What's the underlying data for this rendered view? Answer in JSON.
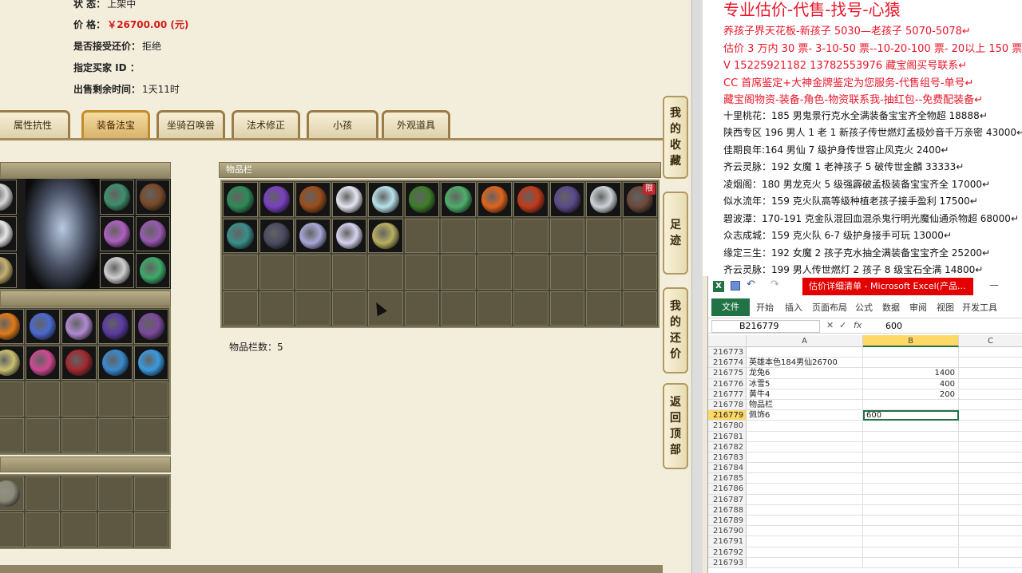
{
  "game": {
    "info": [
      {
        "label": "状      态：",
        "value": "上架中",
        "price": false
      },
      {
        "label": "价      格：",
        "value": "￥26700.00 (元)",
        "price": true
      },
      {
        "label": "是否接受还价：",
        "value": "拒绝",
        "price": false
      },
      {
        "label": "指定买家 ID ：",
        "value": "",
        "price": false
      },
      {
        "label": "出售剩余时间：",
        "value": "1天11时",
        "price": false
      }
    ],
    "tabs": [
      "属性抗性",
      "装备法宝",
      "坐骑召唤兽",
      "法术修正",
      "小孩",
      "外观道具"
    ],
    "active_tab": "装备法宝",
    "inventory_title": "物品栏",
    "inventory_count": "物品栏数：5",
    "limit_badge": "限",
    "side_buttons": [
      {
        "chars": [
          "我",
          "的",
          "收",
          "藏"
        ]
      },
      {
        "chars": [
          "足",
          "迹"
        ]
      },
      {
        "chars": [
          "我",
          "的",
          "还",
          "价"
        ]
      },
      {
        "chars": [
          "返",
          "回",
          "顶",
          "部"
        ]
      }
    ]
  },
  "notes": {
    "title": "专业估价-代售-找号-心猿",
    "lines": [
      {
        "text": "养孩子界天花板-新孩子 5030—老孩子 5070-5078↵",
        "red": true
      },
      {
        "text": "估价 3 万内 30 票- 3-10-50 票--10-20-100 票- 20以上 150 票-1票 1 元↵",
        "red": true
      },
      {
        "text": "V 15225921182    13782553976    藏宝阁买号联系↵",
        "red": true
      },
      {
        "text": "CC 首席鉴定+大神金牌鉴定为您服务-代售组号-单号↵",
        "red": true
      },
      {
        "text": "藏宝阁物资-装备-角色-物资联系我-抽红包--免费配装备↵",
        "red": true
      },
      {
        "text": "十里桃花：185 男鬼景行克水全满装备宝宝齐全物超 18888↵",
        "red": false
      },
      {
        "text": "陕西专区 196 男人 1 老 1 新孩子传世燃灯孟极妙音千万亲密 43000↵",
        "red": false
      },
      {
        "text": "佳期良年:164 男仙 7 级护身传世容止风克火 2400↵",
        "red": false
      },
      {
        "text": "齐云灵脉：192 女魔 1 老神孩子 5 破传世金麟 33333↵",
        "red": false
      },
      {
        "text": "凌烟阁：180 男龙克火 5 级强霹破孟极装备宝宝齐全 17000↵",
        "red": false
      },
      {
        "text": "似水流年：159 克火队高等级种植老孩子接手盈利 17500↵",
        "red": false
      },
      {
        "text": "碧波潭：170-191 克金队混回血混杀鬼行明光魔仙通杀物超 68000↵",
        "red": false
      },
      {
        "text": "众志成城：159 克火队 6-7 级护身接手可玩 13000↵",
        "red": false
      },
      {
        "text": "缘定三生：192 女魔 2 孩子克水抽全满装备宝宝齐全 25200↵",
        "red": false
      },
      {
        "text": "齐云灵脉：199 男人传世燃灯 2 孩子 8 级宝石全满 14800↵",
        "red": false
      }
    ]
  },
  "excel": {
    "title": "估价详细清单 - Microsoft Excel(产品...",
    "ribbon_tabs": [
      "文件",
      "开始",
      "插入",
      "页面布局",
      "公式",
      "数据",
      "审阅",
      "视图",
      "开发工具"
    ],
    "name_box": "B216779",
    "formula_value": "600",
    "columns": [
      "A",
      "B",
      "C"
    ],
    "selected_column": "B",
    "rows": [
      {
        "num": "216773",
        "a": "",
        "b": ""
      },
      {
        "num": "216774",
        "a": "英雄本色184男仙26700",
        "b": ""
      },
      {
        "num": "216775",
        "a": "龙兔6",
        "b": "1400"
      },
      {
        "num": "216776",
        "a": "冰雪5",
        "b": "400"
      },
      {
        "num": "216777",
        "a": "黄牛4",
        "b": "200"
      },
      {
        "num": "216778",
        "a": "物品栏",
        "b": ""
      },
      {
        "num": "216779",
        "a": "佩饰6",
        "b": "600",
        "active": true
      },
      {
        "num": "216780",
        "a": "",
        "b": ""
      },
      {
        "num": "216781",
        "a": "",
        "b": ""
      },
      {
        "num": "216782",
        "a": "",
        "b": ""
      },
      {
        "num": "216783",
        "a": "",
        "b": ""
      },
      {
        "num": "216784",
        "a": "",
        "b": ""
      },
      {
        "num": "216785",
        "a": "",
        "b": ""
      },
      {
        "num": "216786",
        "a": "",
        "b": ""
      },
      {
        "num": "216787",
        "a": "",
        "b": ""
      },
      {
        "num": "216788",
        "a": "",
        "b": ""
      },
      {
        "num": "216789",
        "a": "",
        "b": ""
      },
      {
        "num": "216790",
        "a": "",
        "b": ""
      },
      {
        "num": "216791",
        "a": "",
        "b": ""
      },
      {
        "num": "216792",
        "a": "",
        "b": ""
      },
      {
        "num": "216793",
        "a": "",
        "b": ""
      }
    ]
  },
  "colors": {
    "accent_red": "#e8172a",
    "excel_green": "#217346",
    "price_red": "#d31b1b"
  }
}
